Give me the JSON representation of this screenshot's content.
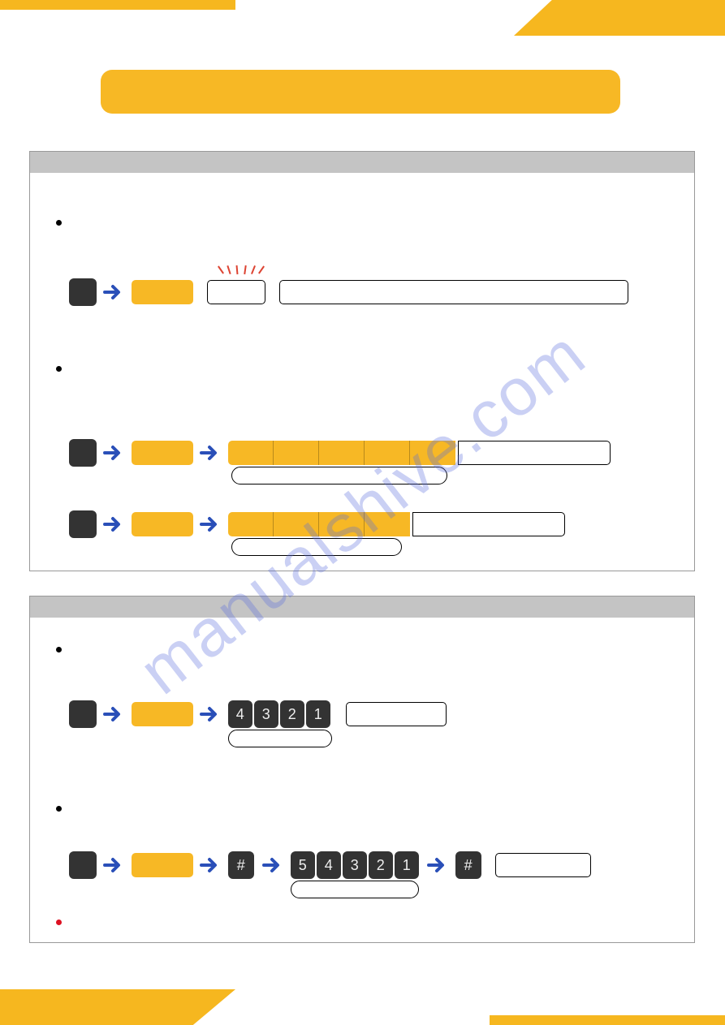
{
  "title": "",
  "watermark": "manualshive.com",
  "section1": {
    "header": "",
    "bullets": [
      {
        "text": ""
      },
      {
        "text": ""
      }
    ],
    "row1": {
      "dark_key": "",
      "gold_key": "",
      "flash_box": "",
      "wide_box": ""
    },
    "row2a": {
      "dark_key": "",
      "gold_key": "",
      "gold_segments": [
        "",
        "",
        "",
        "",
        ""
      ],
      "wide_box": "",
      "pill": ""
    },
    "row2b": {
      "dark_key": "",
      "gold_key": "",
      "gold_segments": [
        "",
        "",
        "",
        ""
      ],
      "wide_box": "",
      "pill": ""
    }
  },
  "section2": {
    "header": "",
    "bullets": [
      {
        "text": ""
      },
      {
        "text": ""
      },
      {
        "text": "",
        "red": true
      }
    ],
    "row1": {
      "dark_key": "",
      "gold_key": "",
      "nums": [
        "4",
        "3",
        "2",
        "1"
      ],
      "wide_box": "",
      "pill": ""
    },
    "row2": {
      "dark_key": "",
      "gold_key": "",
      "hash1": "#",
      "nums": [
        "5",
        "4",
        "3",
        "2",
        "1"
      ],
      "hash2": "#",
      "wide_box": ""
    }
  }
}
